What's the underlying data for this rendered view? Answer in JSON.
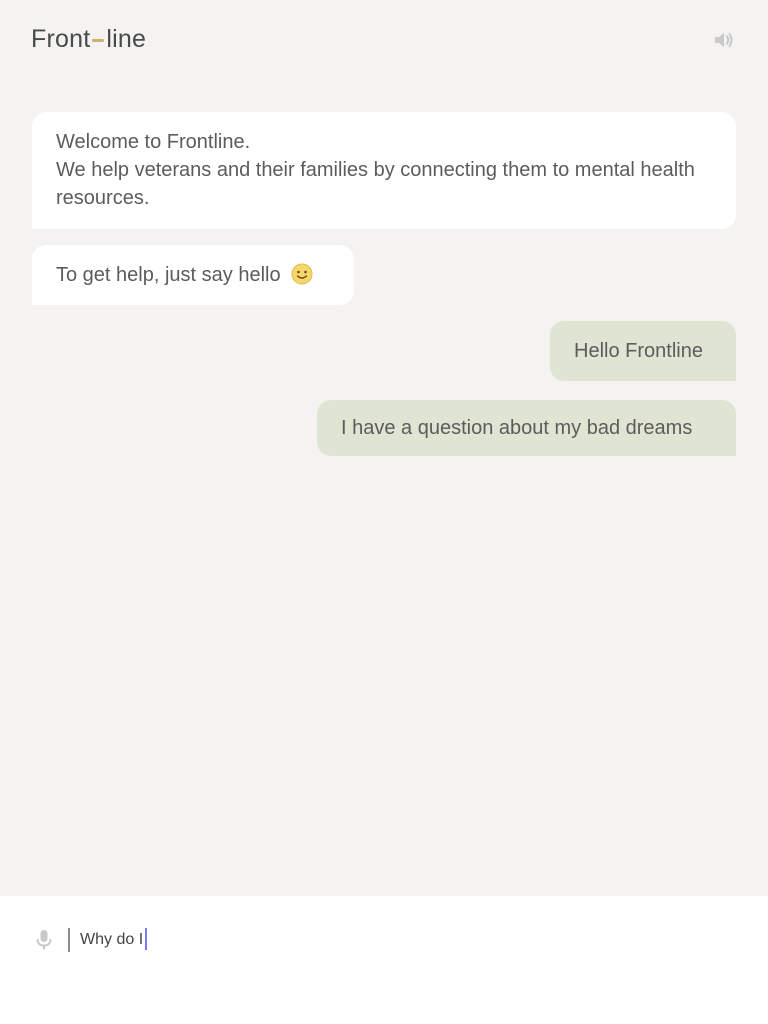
{
  "header": {
    "logo_left": "Front",
    "logo_right": "line",
    "sound_icon": "speaker-icon"
  },
  "colors": {
    "background": "#f4f3f1",
    "bot_bubble": "#ffffff",
    "user_bubble": "#dfe4d3",
    "logo_accent": "#c8b56a",
    "caret": "#7b7bff"
  },
  "messages": [
    {
      "from": "bot",
      "lines": [
        "Welcome to Frontline.",
        "We help veterans and their families by connecting them to mental health resources."
      ]
    },
    {
      "from": "bot",
      "text": "To get help, just say hello",
      "emoji_icon": "smile-emoji-icon"
    },
    {
      "from": "user",
      "text": "Hello Frontline"
    },
    {
      "from": "user",
      "text": "I have a question about my bad dreams"
    }
  ],
  "composer": {
    "mic_icon": "microphone-icon",
    "value": "Why do I"
  }
}
